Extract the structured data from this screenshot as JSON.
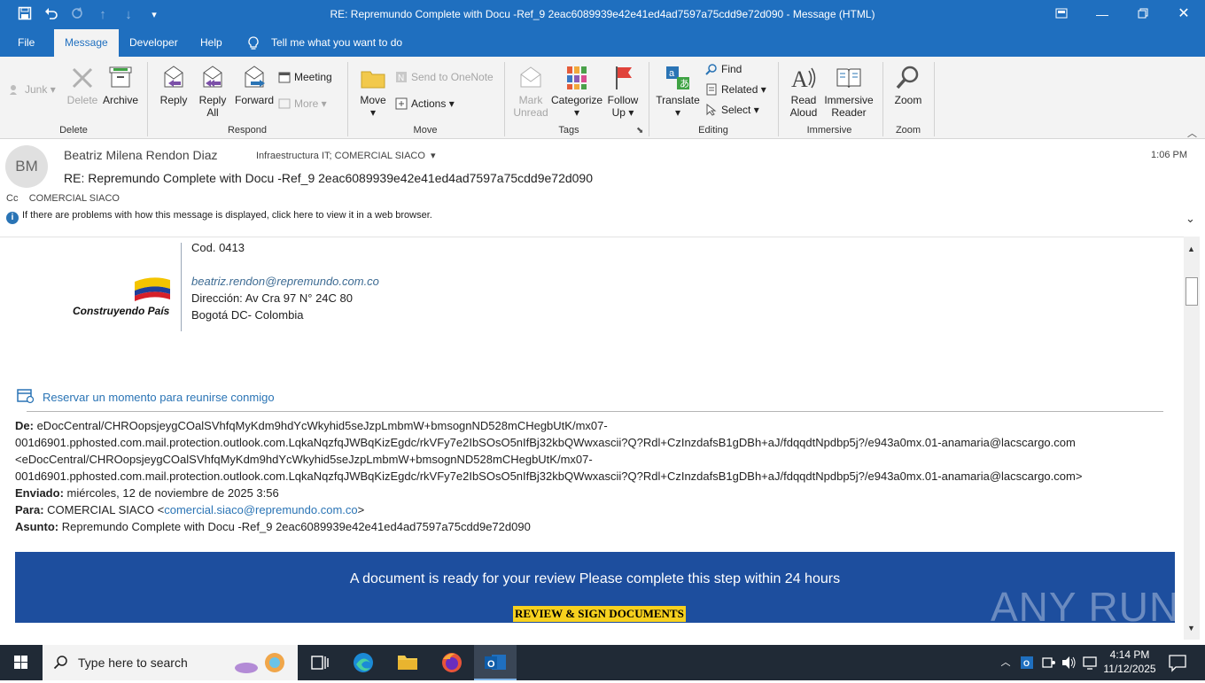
{
  "titlebar": {
    "title": "RE: Repremundo Complete with Docu -Ref_9 2eac6089939e42e41ed4ad7597a75cdd9e72d090  -  Message (HTML)"
  },
  "tabs": [
    "File",
    "Message",
    "Developer",
    "Help"
  ],
  "tell_me": "Tell me what you want to do",
  "ribbon": {
    "delete_group": {
      "label": "Delete",
      "junk": "Junk",
      "delete": "Delete",
      "archive": "Archive"
    },
    "respond_group": {
      "label": "Respond",
      "reply": "Reply",
      "reply_all_1": "Reply",
      "reply_all_2": "All",
      "forward": "Forward",
      "meeting": "Meeting",
      "more": "More"
    },
    "move_group": {
      "label": "Move",
      "move": "Move",
      "onenote": "Send to OneNote",
      "actions": "Actions"
    },
    "tags_group": {
      "label": "Tags",
      "mark_unread_1": "Mark",
      "mark_unread_2": "Unread",
      "categorize": "Categorize",
      "follow_up_1": "Follow",
      "follow_up_2": "Up"
    },
    "editing_group": {
      "label": "Editing",
      "translate": "Translate",
      "find": "Find",
      "related": "Related",
      "select": "Select"
    },
    "immersive_group": {
      "label": "Immersive",
      "read_aloud_1": "Read",
      "read_aloud_2": "Aloud",
      "immersive_reader_1": "Immersive",
      "immersive_reader_2": "Reader"
    },
    "zoom_group": {
      "label": "Zoom",
      "zoom": "Zoom"
    }
  },
  "header": {
    "avatar_initials": "BM",
    "sender": "Beatriz Milena Rendon Diaz",
    "to": "Infraestructura IT; COMERCIAL SIACO",
    "time": "1:06 PM",
    "subject": "RE: Repremundo Complete with Docu -Ref_9 2eac6089939e42e41ed4ad7597a75cdd9e72d090",
    "cc_label": "Cc",
    "cc": "COMERCIAL SIACO",
    "info": "If there are problems with how this message is displayed, click here to view it in a web browser."
  },
  "signature": {
    "code": "Cod. 0413",
    "logo_text": "Construyendo País",
    "email": "beatriz.rendon@repremundo.com.co",
    "address": "Dirección:  Av Cra 97 N° 24C 80",
    "city": "Bogotá DC- Colombia",
    "booking": "Reservar un momento para reunirse conmigo"
  },
  "quoted": {
    "de_label": "De:",
    "de_line1": "eDocCentral/CHROopsjeygCOalSVhfqMyKdm9hdYcWkyhid5seJzpLmbmW+bmsognND528mCHegbUtK/mx07-",
    "de_line2": "001d6901.pphosted.com.mail.protection.outlook.com.LqkaNqzfqJWBqKizEgdc/rkVFy7e2IbSOsO5nIfBj32kbQWwxascii?Q?Rdl+CzInzdafsB1gDBh+aJ/fdqqdtNpdbp5j?/e943a0mx.01-anamaria@lacscargo.com",
    "de_line3": "<eDocCentral/CHROopsjeygCOalSVhfqMyKdm9hdYcWkyhid5seJzpLmbmW+bmsognND528mCHegbUtK/mx07-",
    "de_line4": "001d6901.pphosted.com.mail.protection.outlook.com.LqkaNqzfqJWBqKizEgdc/rkVFy7e2IbSOsO5nIfBj32kbQWwxascii?Q?Rdl+CzInzdafsB1gDBh+aJ/fdqqdtNpdbp5j?/e943a0mx.01-anamaria@lacscargo.com>",
    "enviado_label": "Enviado:",
    "enviado": "miércoles, 12 de noviembre de 2025 3:56",
    "para_label": "Para:",
    "para_name": "COMERCIAL SIACO <",
    "para_email": "comercial.siaco@repremundo.com.co",
    "para_end": ">",
    "asunto_label": "Asunto:",
    "asunto": "Repremundo Complete with Docu -Ref_9 2eac6089939e42e41ed4ad7597a75cdd9e72d090"
  },
  "banner": {
    "message": "A document is ready for your review Please complete this step within 24 hours",
    "cta": "REVIEW & SIGN DOCUMENTS"
  },
  "watermark": "ANY RUN",
  "taskbar": {
    "search_placeholder": "Type here to search",
    "time": "4:14 PM",
    "date": "11/12/2025"
  },
  "colors": {
    "titlebar": "#1f6fbf",
    "banner": "#1d4e9e",
    "cta": "#f7d11e",
    "link": "#2a74b5"
  }
}
